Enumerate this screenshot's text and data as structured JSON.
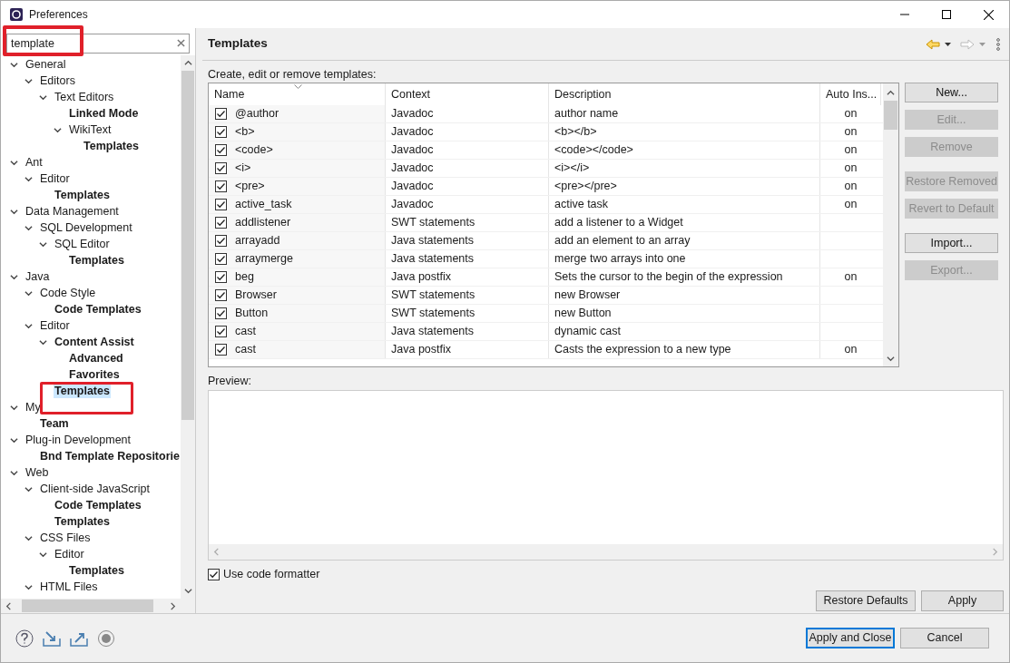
{
  "window": {
    "title": "Preferences"
  },
  "filter": {
    "value": "template"
  },
  "tree": [
    {
      "label": "General",
      "match": false,
      "selected": false,
      "expanded": true,
      "children": [
        {
          "label": "Editors",
          "match": false,
          "selected": false,
          "expanded": true,
          "children": [
            {
              "label": "Text Editors",
              "match": false,
              "selected": false,
              "expanded": true,
              "children": [
                {
                  "label": "Linked Mode",
                  "match": true,
                  "selected": false
                },
                {
                  "label": "WikiText",
                  "match": false,
                  "selected": false,
                  "expanded": true,
                  "children": [
                    {
                      "label": "Templates",
                      "match": true,
                      "selected": false
                    }
                  ]
                }
              ]
            }
          ]
        }
      ]
    },
    {
      "label": "Ant",
      "match": false,
      "selected": false,
      "expanded": true,
      "children": [
        {
          "label": "Editor",
          "match": false,
          "selected": false,
          "expanded": true,
          "children": [
            {
              "label": "Templates",
              "match": true,
              "selected": false
            }
          ]
        }
      ]
    },
    {
      "label": "Data Management",
      "match": false,
      "selected": false,
      "expanded": true,
      "children": [
        {
          "label": "SQL Development",
          "match": false,
          "selected": false,
          "expanded": true,
          "children": [
            {
              "label": "SQL Editor",
              "match": false,
              "selected": false,
              "expanded": true,
              "children": [
                {
                  "label": "Templates",
                  "match": true,
                  "selected": false
                }
              ]
            }
          ]
        }
      ]
    },
    {
      "label": "Java",
      "match": false,
      "selected": false,
      "expanded": true,
      "children": [
        {
          "label": "Code Style",
          "match": false,
          "selected": false,
          "expanded": true,
          "children": [
            {
              "label": "Code Templates",
              "match": true,
              "selected": false
            }
          ]
        },
        {
          "label": "Editor",
          "match": false,
          "selected": false,
          "expanded": true,
          "children": [
            {
              "label": "Content Assist",
              "match": true,
              "selected": false,
              "expanded": true,
              "children": [
                {
                  "label": "Advanced",
                  "match": true,
                  "selected": false
                },
                {
                  "label": "Favorites",
                  "match": true,
                  "selected": false
                }
              ]
            },
            {
              "label": "Templates",
              "match": true,
              "selected": true
            }
          ]
        }
      ]
    },
    {
      "label": "My",
      "match": false,
      "selected": false,
      "expanded": true,
      "children": [
        {
          "label": "Team",
          "match": true,
          "selected": false
        }
      ]
    },
    {
      "label": "Plug-in Development",
      "match": false,
      "selected": false,
      "expanded": true,
      "children": [
        {
          "label": "Bnd Template Repositorie",
          "match": true,
          "selected": false
        }
      ]
    },
    {
      "label": "Web",
      "match": false,
      "selected": false,
      "expanded": true,
      "children": [
        {
          "label": "Client-side JavaScript",
          "match": false,
          "selected": false,
          "expanded": true,
          "children": [
            {
              "label": "Code Templates",
              "match": true,
              "selected": false
            },
            {
              "label": "Templates",
              "match": true,
              "selected": false
            }
          ]
        },
        {
          "label": "CSS Files",
          "match": false,
          "selected": false,
          "expanded": true,
          "children": [
            {
              "label": "Editor",
              "match": false,
              "selected": false,
              "expanded": true,
              "children": [
                {
                  "label": "Templates",
                  "match": true,
                  "selected": false
                }
              ]
            }
          ]
        },
        {
          "label": "HTML Files",
          "match": false,
          "selected": false,
          "expanded": true
        }
      ]
    }
  ],
  "page": {
    "title": "Templates",
    "subtitle": "Create, edit or remove templates:"
  },
  "table": {
    "columns": [
      "Name",
      "Context",
      "Description",
      "Auto Ins..."
    ],
    "rows": [
      {
        "checked": true,
        "name": "@author",
        "context": "Javadoc",
        "description": "author name",
        "auto_insert": "on"
      },
      {
        "checked": true,
        "name": "<b>",
        "context": "Javadoc",
        "description": "<b></b>",
        "auto_insert": "on"
      },
      {
        "checked": true,
        "name": "<code>",
        "context": "Javadoc",
        "description": "<code></code>",
        "auto_insert": "on"
      },
      {
        "checked": true,
        "name": "<i>",
        "context": "Javadoc",
        "description": "<i></i>",
        "auto_insert": "on"
      },
      {
        "checked": true,
        "name": "<pre>",
        "context": "Javadoc",
        "description": "<pre></pre>",
        "auto_insert": "on"
      },
      {
        "checked": true,
        "name": "active_task",
        "context": "Javadoc",
        "description": "active task",
        "auto_insert": "on"
      },
      {
        "checked": true,
        "name": "addlistener",
        "context": "SWT statements",
        "description": "add a listener to a Widget"
      },
      {
        "checked": true,
        "name": "arrayadd",
        "context": "Java statements",
        "description": "add an element to an array"
      },
      {
        "checked": true,
        "name": "arraymerge",
        "context": "Java statements",
        "description": "merge two arrays into one"
      },
      {
        "checked": true,
        "name": "beg",
        "context": "Java postfix",
        "description": "Sets the cursor to the begin of the expression",
        "auto_insert": "on"
      },
      {
        "checked": true,
        "name": "Browser",
        "context": "SWT statements",
        "description": "new Browser"
      },
      {
        "checked": true,
        "name": "Button",
        "context": "SWT statements",
        "description": "new Button"
      },
      {
        "checked": true,
        "name": "cast",
        "context": "Java statements",
        "description": "dynamic cast"
      },
      {
        "checked": true,
        "name": "cast",
        "context": "Java postfix",
        "description": "Casts the expression to a new type",
        "auto_insert": "on"
      }
    ]
  },
  "side_buttons": [
    {
      "label": "New...",
      "disabled": false
    },
    {
      "label": "Edit...",
      "disabled": true
    },
    {
      "label": "Remove",
      "disabled": true
    },
    {
      "label": "Restore Removed",
      "disabled": true
    },
    {
      "label": "Revert to Default",
      "disabled": true
    },
    {
      "label": "Import...",
      "disabled": false
    },
    {
      "label": "Export...",
      "disabled": true
    }
  ],
  "preview": {
    "label": "Preview:"
  },
  "use_code_formatter": {
    "label": "Use code formatter",
    "checked": true
  },
  "page_buttons": [
    "Restore Defaults",
    "Apply"
  ],
  "footer_buttons": [
    {
      "label": "Apply and Close",
      "default": true
    },
    {
      "label": "Cancel",
      "default": false
    }
  ]
}
